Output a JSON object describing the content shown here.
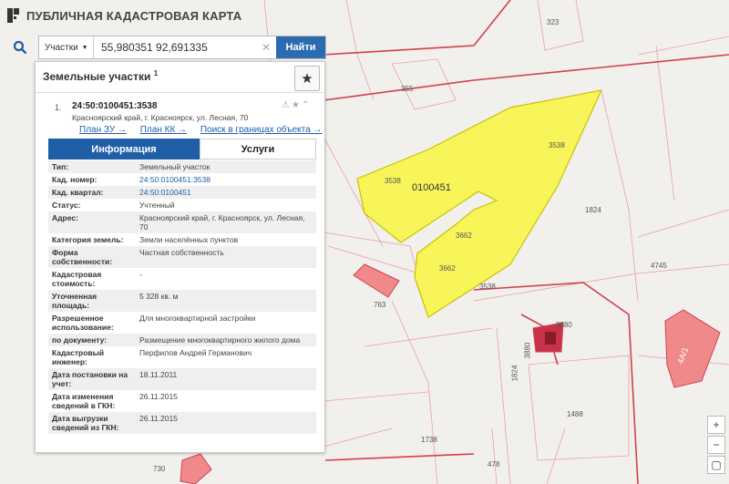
{
  "app": {
    "title": "ПУБЛИЧНАЯ КАДАСТРОВАЯ КАРТА"
  },
  "search": {
    "type_label": "Участки",
    "value": "55,980351 92,691335",
    "find_label": "Найти"
  },
  "panel": {
    "title": "Земельные участки",
    "title_sup": "1"
  },
  "result": {
    "num": "1.",
    "cad_number": "24:50:0100451:3538",
    "address": "Красноярский край, г. Красноярск, ул. Лесная, 70",
    "links": [
      "План ЗУ →",
      "План КК →",
      "Поиск в границах объекта →"
    ],
    "tabs": [
      "Информация",
      "Услуги"
    ],
    "rows": [
      {
        "k": "Тип:",
        "v": "Земельный участок"
      },
      {
        "k": "Кад. номер:",
        "v": "24:50:0100451:3538"
      },
      {
        "k": "Кад. квартал:",
        "v": "24:50:0100451"
      },
      {
        "k": "Статус:",
        "v": "Учтенный"
      },
      {
        "k": "Адрес:",
        "v": "Красноярский край, г. Красноярск, ул. Лесная, 70"
      },
      {
        "k": "Категория земель:",
        "v": "Земли населённых пунктов"
      },
      {
        "k": "Форма собственности:",
        "v": "Частная собственность"
      },
      {
        "k": "Кадастровая стоимость:",
        "v": "-"
      },
      {
        "k": "Уточненная площадь:",
        "v": "5 328 кв. м"
      },
      {
        "k": "Разрешенное использование:",
        "v": "Для многоквартирной застройки"
      },
      {
        "k": "по документу:",
        "v": "Размещение многоквартирного жилого дома"
      },
      {
        "k": "Кадастровый инженер:",
        "v": "Перфилов Андрей Германович"
      },
      {
        "k": "Дата постановки на учет:",
        "v": "18.11.2011"
      },
      {
        "k": "Дата изменения сведений в ГКН:",
        "v": "26.11.2015"
      },
      {
        "k": "Дата выгрузки сведений из ГКН:",
        "v": "26.11.2015"
      }
    ]
  },
  "map": {
    "labels": {
      "p323": "323",
      "p355": "355",
      "q0100451": "0100451",
      "a3538_1": "3538",
      "a3538_2": "3538",
      "a3538_3": "3538",
      "a3662_1": "3662",
      "a3662_2": "3662",
      "a1824_1": "1824",
      "a4745": "4745",
      "a763": "763",
      "a3880_1": "3880",
      "a3880_2": "3880",
      "a1824_2": "1824",
      "a1488": "1488",
      "a1738": "1738",
      "a478": "478",
      "a730": "730",
      "b4a1": "4А/1"
    }
  },
  "colors": {
    "parcel_fill": "#f7f55a",
    "parcel_line": "#c9c200",
    "boundary": "#e06070",
    "building": "#f08a8a",
    "accent": "#1f5fa8"
  },
  "icons": {
    "logo": "logo-icon",
    "search": "search-icon",
    "clear": "clear-icon",
    "star": "star-icon",
    "zoom_in": "plus-icon",
    "zoom_out": "minus-icon"
  }
}
